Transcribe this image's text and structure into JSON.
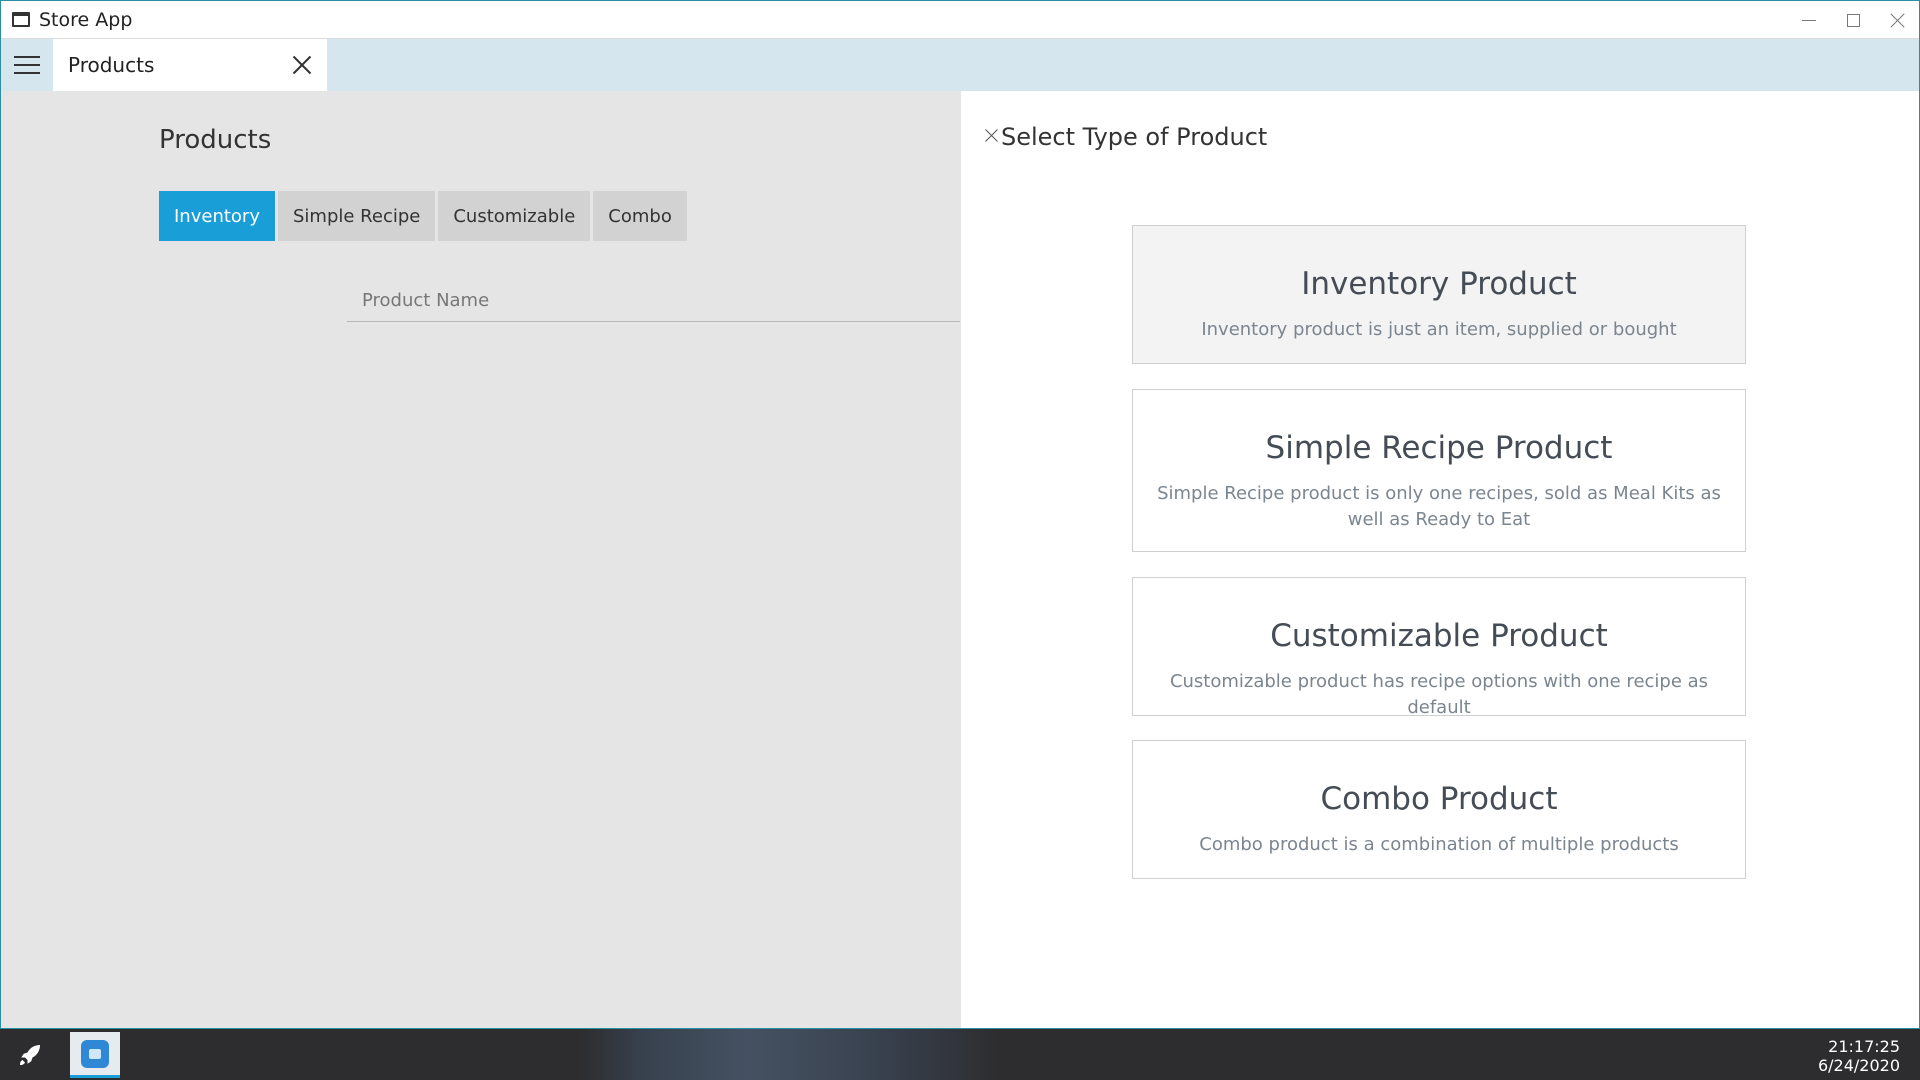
{
  "window": {
    "title": "Store App"
  },
  "tabbar": {
    "tab_label": "Products"
  },
  "products_page": {
    "title": "Products",
    "tabs": [
      {
        "label": "Inventory",
        "active": true
      },
      {
        "label": "Simple Recipe",
        "active": false
      },
      {
        "label": "Customizable",
        "active": false
      },
      {
        "label": "Combo",
        "active": false
      }
    ],
    "name_placeholder": "Product Name"
  },
  "select_panel": {
    "title": "Select Type of Product",
    "options": [
      {
        "title": "Inventory Product",
        "description": "Inventory product is just an item, supplied or bought"
      },
      {
        "title": "Simple Recipe Product",
        "description": "Simple Recipe product is only one recipes, sold as Meal Kits as well as Ready to Eat"
      },
      {
        "title": "Customizable Product",
        "description": "Customizable product has recipe options with one recipe as default"
      },
      {
        "title": "Combo Product",
        "description": "Combo product is a combination of multiple products"
      }
    ]
  },
  "taskbar": {
    "time": "21:17:25",
    "date": "6/24/2020"
  },
  "colors": {
    "accent": "#1a9ed8",
    "tabbar_bg": "#d6e6ee",
    "pane_bg": "#e5e5e5"
  },
  "icons": {
    "window_icon": "window-icon",
    "menu": "hamburger-menu-icon",
    "close": "close-icon",
    "launcher": "rocket-icon",
    "task_app": "store-app-icon"
  }
}
